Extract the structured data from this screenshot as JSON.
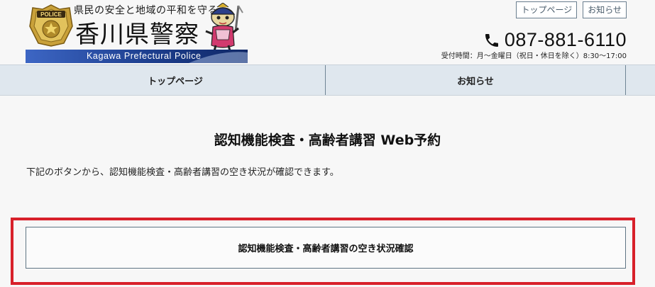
{
  "header": {
    "tagline": "県民の安全と地域の平和を守る。",
    "site_name": "香川県警察",
    "english_name": "Kagawa Prefectural Police",
    "badge_text": "POLICE",
    "top_links": [
      "トップページ",
      "お知らせ"
    ],
    "phone_icon": "phone-icon",
    "phone_number": "087-881-6110",
    "hours": "受付時間：月～金曜日（祝日・休日を除く）8:30～17:00"
  },
  "nav": {
    "items": [
      "トップページ",
      "お知らせ"
    ]
  },
  "main": {
    "title": "認知機能検査・高齢者講習 Web予約",
    "intro": "下記のボタンから、認知機能検査・高齢者講習の空き状況が確認できます。",
    "button_label": "認知機能検査・高齢者講習の空き状況確認"
  },
  "colors": {
    "nav_background": "#dfe7ee",
    "highlight_border": "#d8202a",
    "logo_blue": "#1d3f8f",
    "badge_gold": "#c9a13a"
  }
}
